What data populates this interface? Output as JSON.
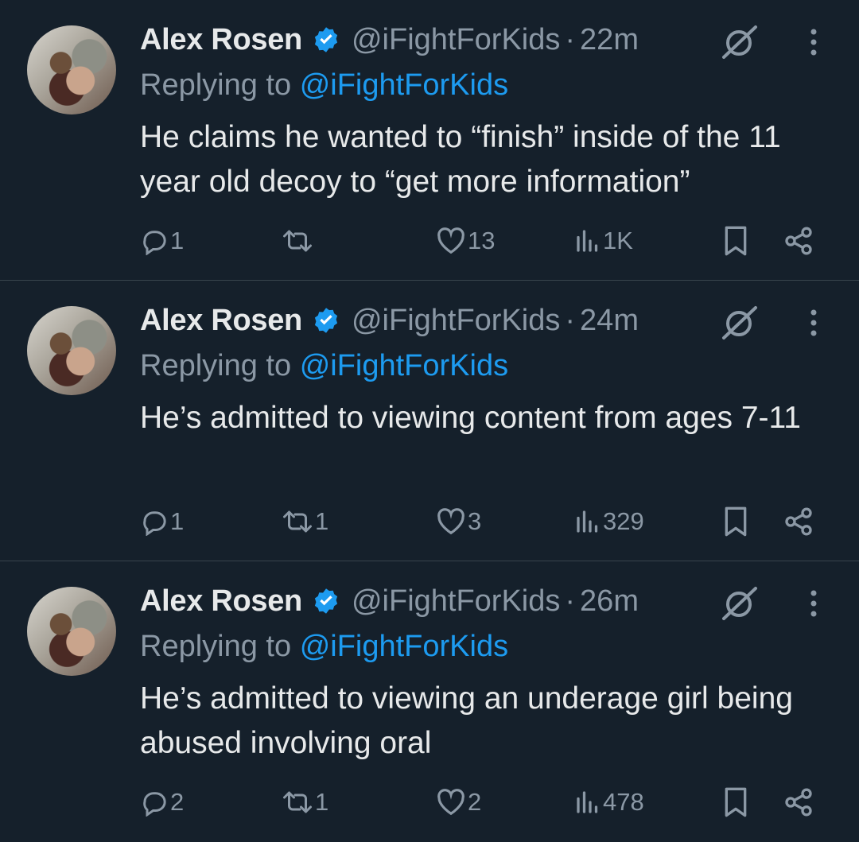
{
  "tweets": [
    {
      "name": "Alex Rosen",
      "handle": "@iFightForKids",
      "time": "22m",
      "replying_label": "Replying to",
      "replying_to": "@iFightForKids",
      "text": "He claims he wanted to “finish” inside of the 11 year old decoy to “get more information”",
      "replies": "1",
      "reposts": "",
      "likes": "13",
      "views": "1K"
    },
    {
      "name": "Alex Rosen",
      "handle": "@iFightForKids",
      "time": "24m",
      "replying_label": "Replying to",
      "replying_to": "@iFightForKids",
      "text": "He’s admitted to viewing content from ages 7-11",
      "replies": "1",
      "reposts": "1",
      "likes": "3",
      "views": "329"
    },
    {
      "name": "Alex Rosen",
      "handle": "@iFightForKids",
      "time": "26m",
      "replying_label": "Replying to",
      "replying_to": "@iFightForKids",
      "text": "He’s admitted to viewing an underage girl being abused involving oral",
      "replies": "2",
      "reposts": "1",
      "likes": "2",
      "views": "478"
    }
  ],
  "separator": "·",
  "icons": [
    "verified-badge-icon",
    "grok-icon",
    "more-icon",
    "reply-icon",
    "repost-icon",
    "like-icon",
    "views-icon",
    "bookmark-icon",
    "share-icon"
  ],
  "colors": {
    "background": "#15202b",
    "text": "#e7e9ea",
    "muted": "#8b98a5",
    "accent": "#1d9bf0",
    "divider": "#38444d"
  }
}
